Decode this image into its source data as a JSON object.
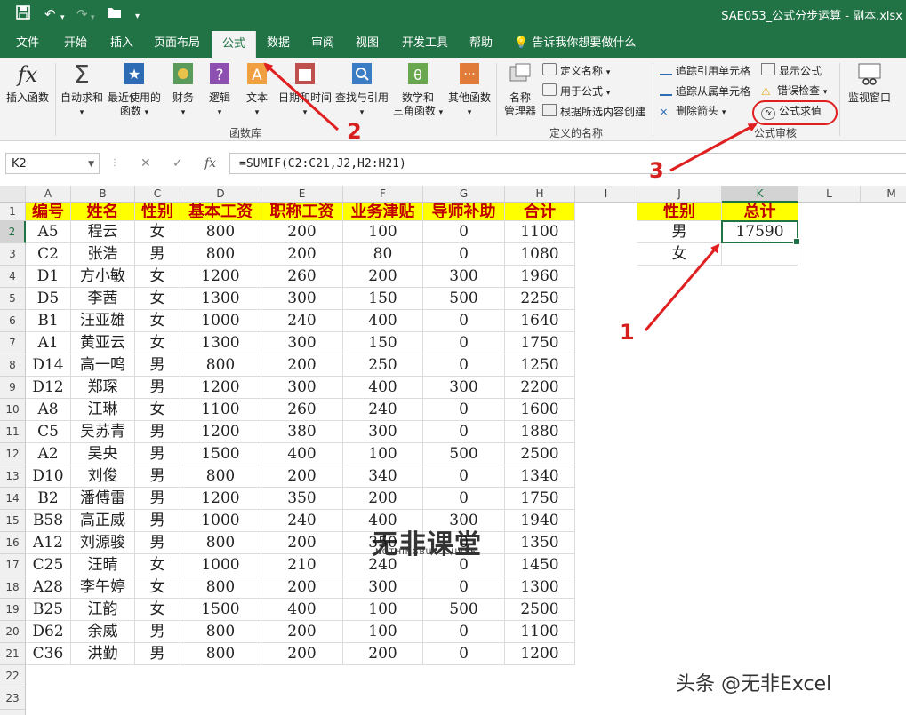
{
  "titlebar": {
    "title": "SAE053_公式分步运算 - 副本.xlsx",
    "save_icon": "save-icon",
    "undo_icon": "undo-icon",
    "redo_icon": "redo-icon",
    "open_icon": "open-folder-icon"
  },
  "tabs": [
    "文件",
    "开始",
    "插入",
    "页面布局",
    "公式",
    "数据",
    "审阅",
    "视图",
    "开发工具",
    "帮助"
  ],
  "active_tab": "公式",
  "tell_me": "告诉我你想要做什么",
  "ribbon": {
    "insert_function": "插入函数",
    "autosum": "自动求和",
    "recent_l1": "最近使用的",
    "recent_l2": "函数",
    "finance": "财务",
    "logic": "逻辑",
    "text": "文本",
    "datetime": "日期和时间",
    "lookup": "查找与引用",
    "math_l1": "数学和",
    "math_l2": "三角函数",
    "other": "其他函数",
    "group_library": "函数库",
    "name_mgr_l1": "名称",
    "name_mgr_l2": "管理器",
    "define_name": "定义名称",
    "use_in_formula": "用于公式",
    "create_from_sel": "根据所选内容创建",
    "group_names": "定义的名称",
    "trace_precedents": "追踪引用单元格",
    "trace_dependents": "追踪从属单元格",
    "remove_arrows": "删除箭头",
    "show_formulas": "显示公式",
    "error_check": "错误检查",
    "evaluate_formula": "公式求值",
    "group_audit": "公式审核",
    "watch_window": "监视窗口",
    "fx_symbol": "fx"
  },
  "formula_bar": {
    "name_box": "K2",
    "fx": "fx",
    "cancel": "✕",
    "enter": "✓",
    "formula": "=SUMIF(C2:C21,J2,H2:H21)"
  },
  "columns": [
    "A",
    "B",
    "C",
    "D",
    "E",
    "F",
    "G",
    "H",
    "I",
    "J",
    "K",
    "L",
    "M"
  ],
  "rows": [
    "1",
    "2",
    "3",
    "4",
    "5",
    "6",
    "7",
    "8",
    "9",
    "10",
    "11",
    "12",
    "13",
    "14",
    "15",
    "16",
    "17",
    "18",
    "19",
    "20",
    "21",
    "22",
    "23",
    "24"
  ],
  "table": {
    "headers": [
      "编号",
      "姓名",
      "性别",
      "基本工资",
      "职称工资",
      "业务津贴",
      "导师补助",
      "合计"
    ],
    "data": [
      [
        "A5",
        "程云",
        "女",
        "800",
        "200",
        "100",
        "0",
        "1100"
      ],
      [
        "C2",
        "张浩",
        "男",
        "800",
        "200",
        "80",
        "0",
        "1080"
      ],
      [
        "D1",
        "方小敏",
        "女",
        "1200",
        "260",
        "200",
        "300",
        "1960"
      ],
      [
        "D5",
        "李茜",
        "女",
        "1300",
        "300",
        "150",
        "500",
        "2250"
      ],
      [
        "B1",
        "汪亚雄",
        "女",
        "1000",
        "240",
        "400",
        "0",
        "1640"
      ],
      [
        "A1",
        "黄亚云",
        "女",
        "1300",
        "300",
        "150",
        "0",
        "1750"
      ],
      [
        "D14",
        "高一鸣",
        "男",
        "800",
        "200",
        "250",
        "0",
        "1250"
      ],
      [
        "D12",
        "郑琛",
        "男",
        "1200",
        "300",
        "400",
        "300",
        "2200"
      ],
      [
        "A8",
        "江琳",
        "女",
        "1100",
        "260",
        "240",
        "0",
        "1600"
      ],
      [
        "C5",
        "吴苏青",
        "男",
        "1200",
        "380",
        "300",
        "0",
        "1880"
      ],
      [
        "A2",
        "吴央",
        "男",
        "1500",
        "400",
        "100",
        "500",
        "2500"
      ],
      [
        "D10",
        "刘俊",
        "男",
        "800",
        "200",
        "340",
        "0",
        "1340"
      ],
      [
        "B2",
        "潘傅雷",
        "男",
        "1200",
        "350",
        "200",
        "0",
        "1750"
      ],
      [
        "B58",
        "高正威",
        "男",
        "1000",
        "240",
        "400",
        "300",
        "1940"
      ],
      [
        "A12",
        "刘源骏",
        "男",
        "800",
        "200",
        "350",
        "0",
        "1350"
      ],
      [
        "C25",
        "汪晴",
        "女",
        "1000",
        "210",
        "240",
        "0",
        "1450"
      ],
      [
        "A28",
        "李午婷",
        "女",
        "800",
        "200",
        "300",
        "0",
        "1300"
      ],
      [
        "B25",
        "江韵",
        "女",
        "1500",
        "400",
        "100",
        "500",
        "2500"
      ],
      [
        "D62",
        "余威",
        "男",
        "800",
        "200",
        "100",
        "0",
        "1100"
      ],
      [
        "C36",
        "洪勤",
        "男",
        "800",
        "200",
        "200",
        "0",
        "1200"
      ]
    ]
  },
  "summary": {
    "headers": [
      "性别",
      "总计"
    ],
    "rows": [
      [
        "男",
        "17590"
      ],
      [
        "女",
        ""
      ]
    ]
  },
  "watermark": {
    "main": "无非课堂",
    "sub": "NOTHINGBUTCOURSE"
  },
  "credit": "头条 @无非Excel",
  "annotations": [
    "1",
    "2",
    "3"
  ],
  "colors": {
    "excel_green": "#217346",
    "header_fill": "#ffff00",
    "header_text": "#c00000",
    "annotation_red": "#e02020"
  }
}
